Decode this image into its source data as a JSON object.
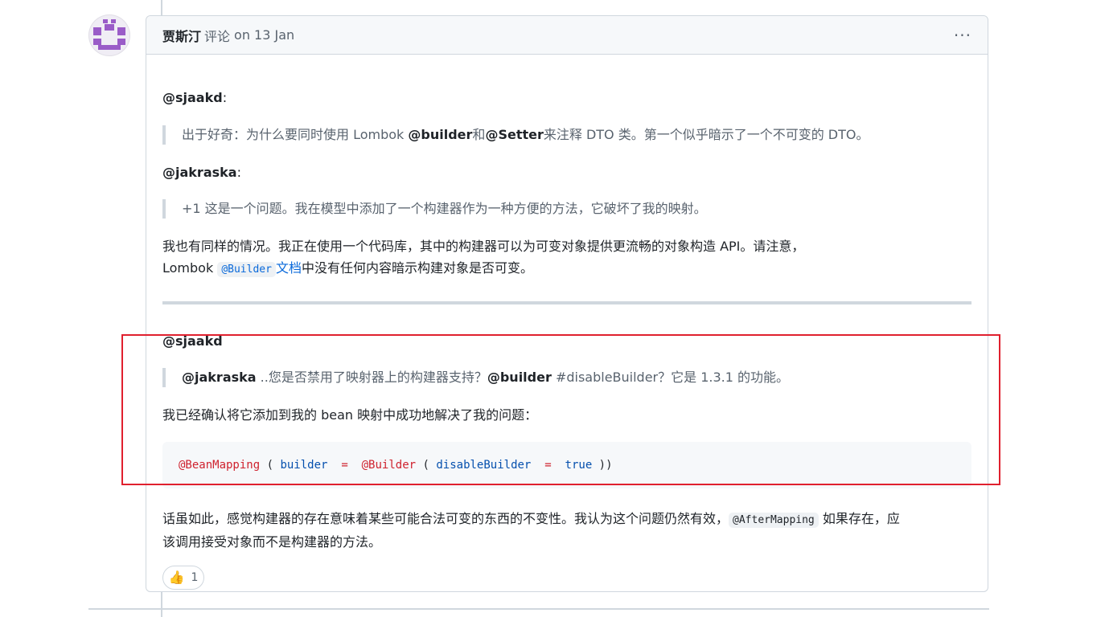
{
  "comment": {
    "author": "贾斯汀",
    "action": "评论",
    "date": "on 13 Jan",
    "menu_icon": "kebab-horizontal-icon",
    "body": {
      "mention1": "@sjaakd",
      "mention1_suffix": ":",
      "quote1": {
        "before": "出于好奇：为什么要同时使用 Lombok ",
        "bold1": "@builder",
        "middle": "和",
        "bold2": "@Setter",
        "after": "来注释 DTO 类。第一个似乎暗示了一个不可变的 DTO。"
      },
      "mention2": "@jakraska",
      "mention2_suffix": ":",
      "quote2": "+1 这是一个问题。我在模型中添加了一个构建器作为一种方便的方法，它破坏了我的映射。",
      "para1_line1": "我也有同样的情况。我正在使用一个代码库，其中的构建器可以为可变对象提供更流畅的对象构造 API。请注意，",
      "para1_line2_prefix": "Lombok ",
      "para1_code": "@Builder",
      "para1_link": "文档",
      "para1_line2_suffix": "中没有任何内容暗示构建对象是否可变。",
      "mention3": "@sjaakd",
      "quote3": {
        "bold1": "@jakraska",
        "text1": " ..您是否禁用了映射器上的构建器支持？",
        "bold2": "@builder",
        "text2": " #disableBuilder？它是 1.3.1 的功能。"
      },
      "para2": "我已经确认将它添加到我的 bean 映射中成功地解决了我的问题：",
      "code": {
        "annotation": "@BeanMapping",
        "open": " ( ",
        "param": "builder",
        "eq": "  =  ",
        "inner_annotation": "@Builder",
        "open2": " ( ",
        "param2": "disableBuilder",
        "eq2": "  =  ",
        "value": "true",
        "close": " ))"
      },
      "para3_line1_prefix": "话虽如此，感觉构建器的存在意味着某些可能合法可变的东西的不变性。我认为这个问题仍然有效，",
      "para3_code": "@AfterMapping",
      "para3_line1_suffix": "如果存在，应",
      "para3_line2": "该调用接受对象而不是构建器的方法。"
    },
    "reaction": {
      "icon": "thumbs-up-icon",
      "emoji": "👍",
      "count": "1"
    }
  },
  "colors": {
    "highlight_box": "#e0202e",
    "link": "#0969da",
    "annotation": "#cf222e",
    "identifier": "#0550ae",
    "avatar": "#9a5cc8"
  }
}
